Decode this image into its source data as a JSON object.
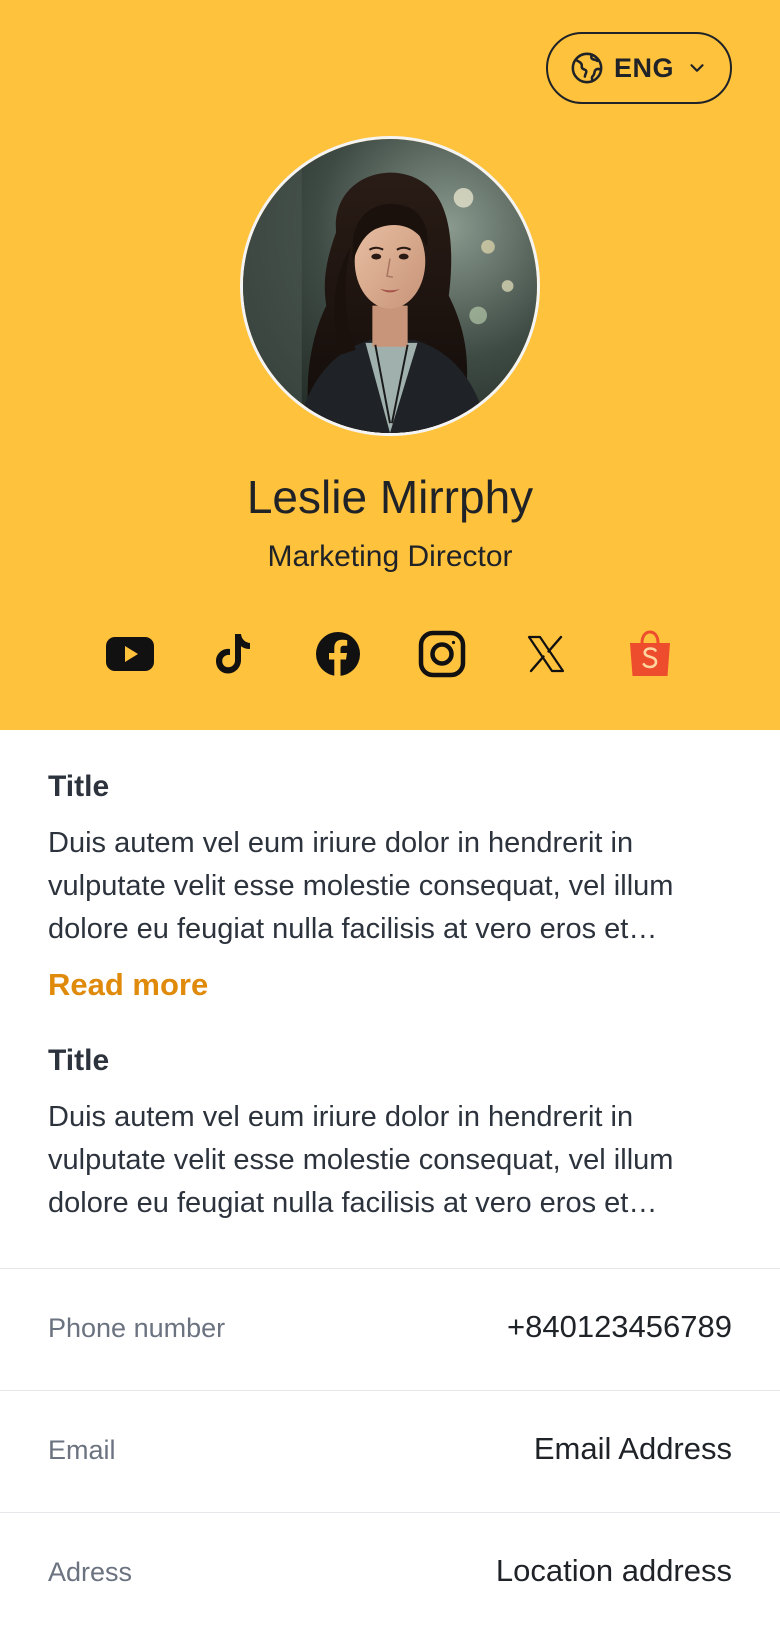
{
  "language": {
    "label": "ENG",
    "icon": "globe-icon"
  },
  "profile": {
    "name": "Leslie Mirrphy",
    "role": "Marketing Director",
    "avatar": "avatar-photo"
  },
  "socials": [
    {
      "name": "youtube",
      "icon": "youtube-icon"
    },
    {
      "name": "tiktok",
      "icon": "tiktok-icon"
    },
    {
      "name": "facebook",
      "icon": "facebook-icon"
    },
    {
      "name": "instagram",
      "icon": "instagram-icon"
    },
    {
      "name": "x",
      "icon": "x-icon"
    },
    {
      "name": "shopee",
      "icon": "shopee-icon"
    }
  ],
  "about": [
    {
      "title": "Title",
      "text": "Duis autem vel eum iriure dolor in hendrerit in vulputate velit esse molestie consequat, vel illum dolore eu feugiat nulla facilisis at vero eros et…",
      "read_more": "Read more"
    },
    {
      "title": "Title",
      "text": "Duis autem vel eum iriure dolor in hendrerit in vulputate velit esse molestie consequat, vel illum dolore eu feugiat nulla facilisis at vero eros et…"
    }
  ],
  "contact": {
    "phone": {
      "label": "Phone number",
      "value": "+840123456789"
    },
    "email": {
      "label": "Email",
      "value": "Email Address"
    },
    "address": {
      "label": "Adress",
      "value": "Location address"
    }
  },
  "colors": {
    "hero_background": "#FFC23C",
    "accent": "#E08A0B",
    "text": "#1f2328",
    "muted": "#6b7280",
    "shopee": "#EE4D2D"
  }
}
